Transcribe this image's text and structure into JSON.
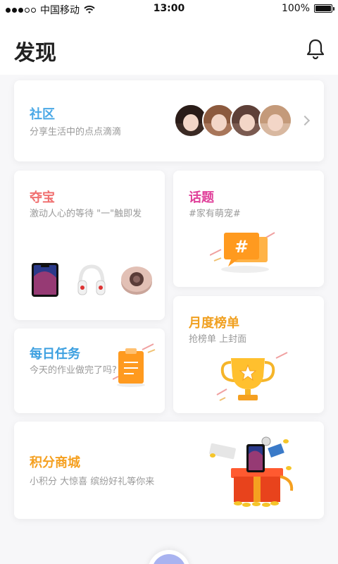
{
  "status_bar": {
    "carrier": "中国移动",
    "time": "13:00",
    "battery": "100%"
  },
  "header": {
    "title": "发现"
  },
  "cards": {
    "community": {
      "title": "社区",
      "subtitle": "分享生活中的点点滴滴",
      "title_color": "#4aa8e6"
    },
    "treasure": {
      "title": "夺宝",
      "subtitle": "激动人心的等待 \"一\"触即发",
      "title_color": "#f07070"
    },
    "topic": {
      "title": "话题",
      "subtitle": "#家有萌宠#",
      "title_color": "#e0409a"
    },
    "ranking": {
      "title": "月度榜单",
      "subtitle": "抢榜单 上封面",
      "title_color": "#f0a020"
    },
    "daily_task": {
      "title": "每日任务",
      "subtitle": "今天的作业做完了吗?",
      "title_color": "#3da0e0"
    },
    "points_mall": {
      "title": "积分商城",
      "subtitle": "小积分 大惊喜 缤纷好礼等你来",
      "title_color": "#f5a020"
    }
  },
  "icons": {
    "bell": "bell-icon",
    "chevron": "chevron-right-icon",
    "topic": "hash-bubble-icon",
    "trophy": "trophy-icon",
    "task": "clipboard-icon",
    "gift": "gift-box-icon"
  }
}
